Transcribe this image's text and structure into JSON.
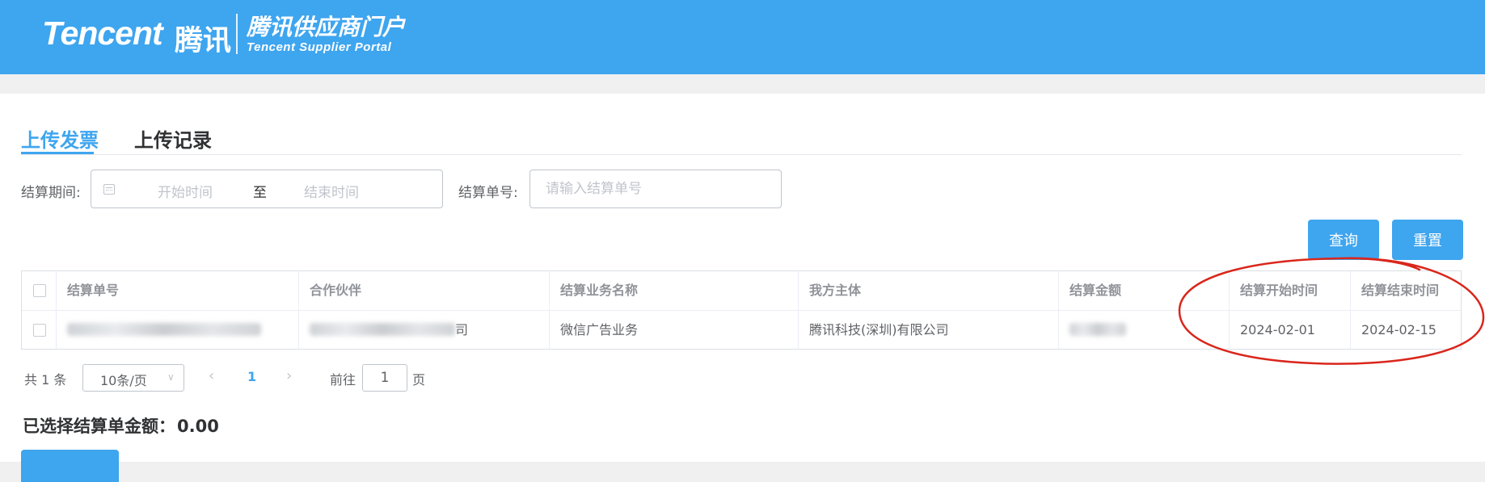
{
  "header": {
    "logo_en": "Tencent",
    "logo_cn": "腾讯",
    "portal_cn": "腾讯供应商门户",
    "portal_en": "Tencent Supplier Portal"
  },
  "tabs": [
    {
      "label": "上传发票",
      "active": true
    },
    {
      "label": "上传记录",
      "active": false
    }
  ],
  "filters": {
    "period_label": "结算期间:",
    "start_placeholder": "开始时间",
    "range_separator": "至",
    "end_placeholder": "结束时间",
    "order_label": "结算单号:",
    "order_placeholder": "请输入结算单号"
  },
  "buttons": {
    "query": "查询",
    "reset": "重置"
  },
  "table": {
    "columns": [
      "结算单号",
      "合作伙伴",
      "结算业务名称",
      "我方主体",
      "结算金额",
      "结算开始时间",
      "结算结束时间"
    ],
    "rows": [
      {
        "partner_suffix": "司",
        "business_name": "微信广告业务",
        "entity": "腾讯科技(深圳)有限公司",
        "start_date": "2024-02-01",
        "end_date": "2024-02-15"
      }
    ]
  },
  "pagination": {
    "total": "共 1 条",
    "page_size": "10条/页",
    "current_page": "1",
    "goto_label": "前往",
    "goto_value": "1",
    "page_unit": "页"
  },
  "summary": {
    "label": "已选择结算单金额：",
    "amount": "0.00"
  },
  "colors": {
    "brand": "#3ea5ef",
    "annotation": "#d9261c"
  }
}
